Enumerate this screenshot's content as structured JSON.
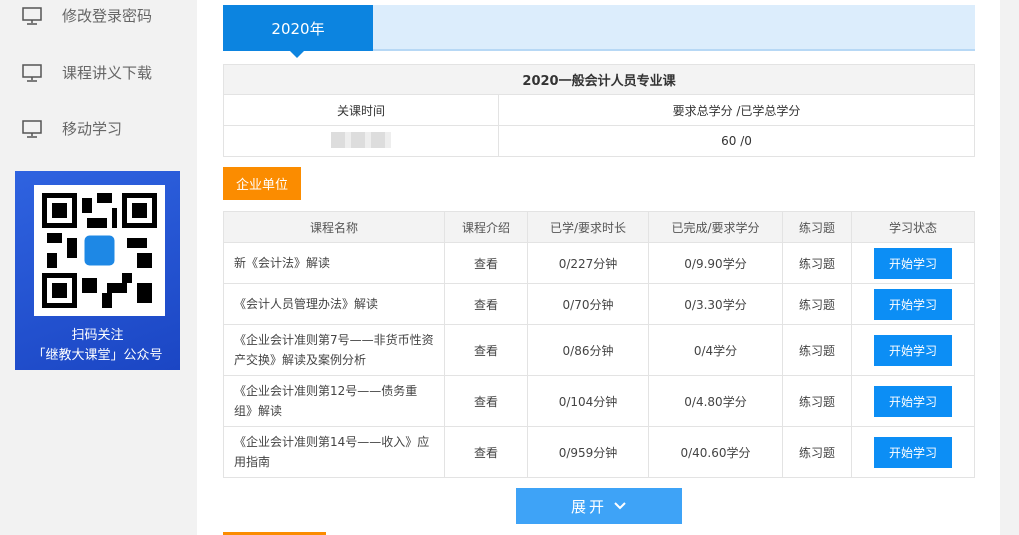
{
  "sidebar": {
    "items": [
      {
        "label": "修改登录密码",
        "icon": "monitor-icon"
      },
      {
        "label": "课程讲义下载",
        "icon": "monitor-icon"
      },
      {
        "label": "移动学习",
        "icon": "monitor-icon"
      }
    ],
    "qr": {
      "line1": "扫码关注",
      "line2": "「继教大课堂」公众号"
    }
  },
  "year_tab": "2020年",
  "summary": {
    "title": "2020一般会计人员专业课",
    "col1": "关课时间",
    "col2": "要求总学分 /已学总学分",
    "credits": "60 /0"
  },
  "org_label": "企业单位",
  "courses": {
    "headers": [
      "课程名称",
      "课程介绍",
      "已学/要求时长",
      "已完成/要求学分",
      "练习题",
      "学习状态"
    ],
    "rows": [
      {
        "name": "新《会计法》解读",
        "intro": "查看",
        "time": "0/227分钟",
        "credit": "0/9.90学分",
        "exercise": "练习题",
        "action": "开始学习"
      },
      {
        "name": "《会计人员管理办法》解读",
        "intro": "查看",
        "time": "0/70分钟",
        "credit": "0/3.30学分",
        "exercise": "练习题",
        "action": "开始学习"
      },
      {
        "name": "《企业会计准则第7号——非货币性资产交换》解读及案例分析",
        "intro": "查看",
        "time": "0/86分钟",
        "credit": "0/4学分",
        "exercise": "练习题",
        "action": "开始学习"
      },
      {
        "name": "《企业会计准则第12号——债务重组》解读",
        "intro": "查看",
        "time": "0/104分钟",
        "credit": "0/4.80学分",
        "exercise": "练习题",
        "action": "开始学习"
      },
      {
        "name": "《企业会计准则第14号——收入》应用指南",
        "intro": "查看",
        "time": "0/959分钟",
        "credit": "0/40.60学分",
        "exercise": "练习题",
        "action": "开始学习"
      }
    ]
  },
  "expand_label": "展开"
}
